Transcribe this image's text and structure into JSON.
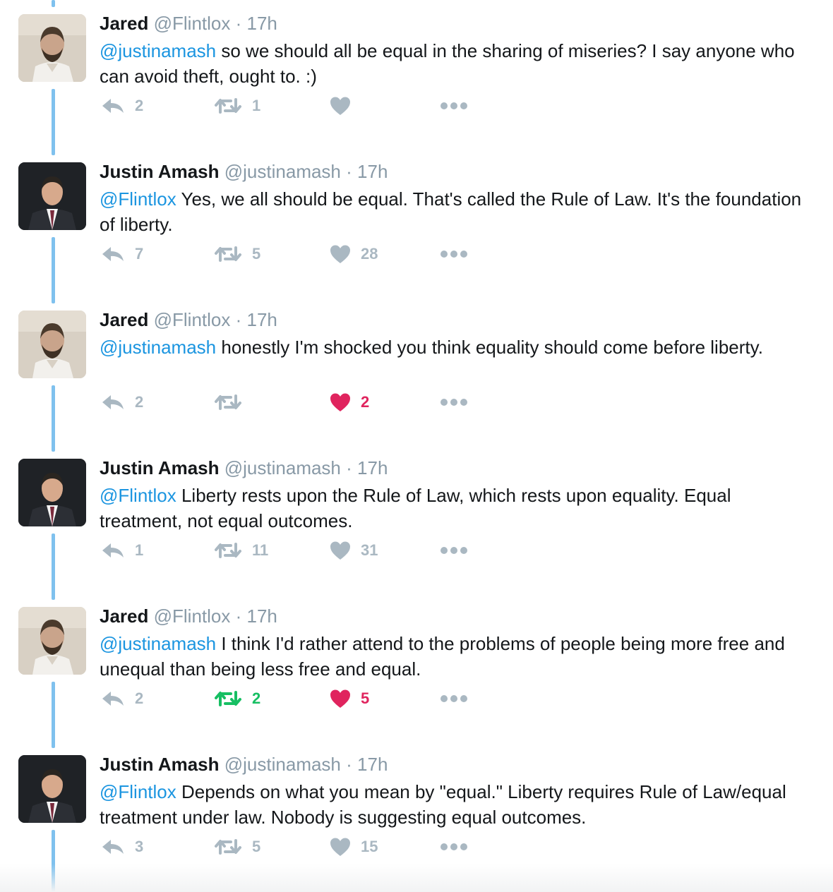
{
  "tweets": [
    {
      "name": "Jared",
      "handle": "@Flintlox",
      "time": "· 17h",
      "avatar": "jared",
      "mention": "@justinamash",
      "text": " so we should all be equal in the sharing of miseries? I say anyone who can avoid theft, ought to. :)",
      "replies": "2",
      "retweets": "1",
      "likes": "",
      "retweeted": false,
      "liked": false
    },
    {
      "name": "Justin Amash",
      "handle": "@justinamash",
      "time": "· 17h",
      "avatar": "justin",
      "mention": "@Flintlox",
      "text": " Yes, we all should be equal. That's called the Rule of Law. It's the foundation of liberty.",
      "replies": "7",
      "retweets": "5",
      "likes": "28",
      "retweeted": false,
      "liked": false
    },
    {
      "name": "Jared",
      "handle": "@Flintlox",
      "time": "· 17h",
      "avatar": "jared",
      "mention": "@justinamash",
      "text": " honestly I'm shocked you think equality should come before liberty.",
      "replies": "2",
      "retweets": "",
      "likes": "2",
      "retweeted": false,
      "liked": true
    },
    {
      "name": "Justin Amash",
      "handle": "@justinamash",
      "time": "· 17h",
      "avatar": "justin",
      "mention": "@Flintlox",
      "text": " Liberty rests upon the Rule of Law, which rests upon equality. Equal treatment, not equal outcomes.",
      "replies": "1",
      "retweets": "11",
      "likes": "31",
      "retweeted": false,
      "liked": false
    },
    {
      "name": "Jared",
      "handle": "@Flintlox",
      "time": "· 17h",
      "avatar": "jared",
      "mention": "@justinamash",
      "text": " I think I'd rather attend to the problems of people being more free and unequal than being less free and equal.",
      "replies": "2",
      "retweets": "2",
      "likes": "5",
      "retweeted": true,
      "liked": true
    },
    {
      "name": "Justin Amash",
      "handle": "@justinamash",
      "time": "· 17h",
      "avatar": "justin",
      "mention": "@Flintlox",
      "text": " Depends on what you mean by \"equal.\" Liberty requires Rule of Law/equal treatment under law. Nobody is suggesting equal outcomes.",
      "replies": "3",
      "retweets": "5",
      "likes": "15",
      "retweeted": false,
      "liked": false
    }
  ],
  "colors": {
    "thread": "#7fc1ee",
    "link": "#1b95e0",
    "icon": "#aab8c2",
    "retweeted": "#17bf63",
    "liked": "#e0245e"
  },
  "icons": {
    "reply": "reply-icon",
    "retweet": "retweet-icon",
    "like": "heart-icon",
    "more": "more-icon"
  }
}
